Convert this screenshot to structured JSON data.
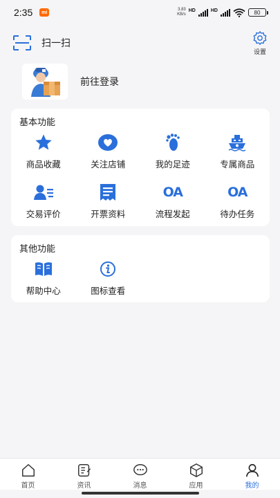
{
  "status": {
    "time": "2:35",
    "speed_value": "3.83",
    "speed_unit": "KB/s",
    "hd1": "HD",
    "hd2": "HD",
    "battery": "80"
  },
  "header": {
    "scan_label": "扫一扫",
    "settings_label": "设置"
  },
  "login": {
    "label": "前往登录"
  },
  "basic": {
    "title": "基本功能",
    "items": [
      {
        "label": "商品收藏",
        "icon": "star-icon"
      },
      {
        "label": "关注店铺",
        "icon": "heart-icon"
      },
      {
        "label": "我的足迹",
        "icon": "footprint-icon"
      },
      {
        "label": "专属商品",
        "icon": "ship-icon"
      },
      {
        "label": "交易评价",
        "icon": "user-review-icon"
      },
      {
        "label": "开票资料",
        "icon": "invoice-icon"
      },
      {
        "label": "流程发起",
        "icon": "oa-icon",
        "text": "OA"
      },
      {
        "label": "待办任务",
        "icon": "oa-icon",
        "text": "OA"
      }
    ]
  },
  "other": {
    "title": "其他功能",
    "items": [
      {
        "label": "帮助中心",
        "icon": "book-icon"
      },
      {
        "label": "图标查看",
        "icon": "info-icon"
      }
    ]
  },
  "tabs": [
    {
      "label": "首页",
      "icon": "home-icon"
    },
    {
      "label": "资讯",
      "icon": "news-icon"
    },
    {
      "label": "消息",
      "icon": "message-icon"
    },
    {
      "label": "应用",
      "icon": "box-icon"
    },
    {
      "label": "我的",
      "icon": "person-icon",
      "active": true
    }
  ],
  "colors": {
    "accent": "#2a6fdb",
    "background": "#f5f5f7",
    "card": "#ffffff"
  }
}
